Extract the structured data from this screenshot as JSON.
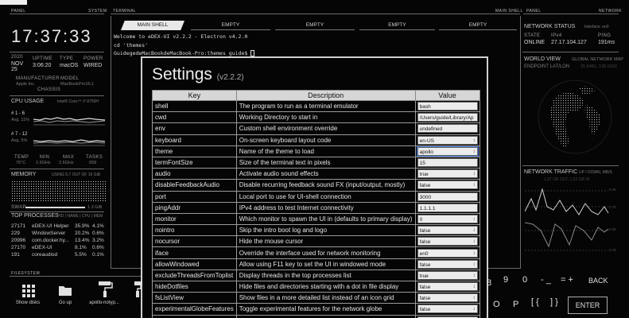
{
  "window": {
    "title": "eDEX-UI"
  },
  "panels": {
    "left": "PANEL",
    "system": "SYSTEM",
    "terminal": "TERMINAL",
    "main_shell_hdr": "MAIN SHELL",
    "right": "PANEL",
    "network": "NETWORK",
    "filesystem": "FILESYSTEM"
  },
  "clock": "17:37:33",
  "sysinfo": {
    "year": "2020",
    "month": "NOV",
    "day": "25",
    "uptime_label": "UPTIME",
    "uptime": "3:06:20",
    "type_label": "TYPE",
    "type": "macOS",
    "power_label": "POWER",
    "power": "WIRED",
    "manufacturer_label": "MANUFACTURER",
    "manufacturer": "Apple Inc.",
    "model_label": "MODEL",
    "model": "MacBookPro16,1",
    "chassis_label": "CHASSIS"
  },
  "cpu": {
    "label": "CPU USAGE",
    "model": "Intel® Core™ i7-9750H",
    "cores1": "# 1 - 6",
    "avg1": "Avg. 11%",
    "cores2": "# 7 - 12",
    "avg2": "Avg. 5%",
    "temp_label": "TEMP",
    "temp": "76°C",
    "min_label": "MIN",
    "min": "2.6GHz",
    "max_label": "MAX",
    "max": "2.6GHz",
    "tasks_label": "TASKS",
    "tasks": "658"
  },
  "memory": {
    "label": "MEMORY",
    "using": "USING 5.7 OUT OF 16 GiB",
    "swap_label": "SWAP",
    "swap": "1.3 GiB"
  },
  "processes": {
    "label": "TOP PROCESSES",
    "cols": "PID | NAME | CPU | MEM",
    "rows": [
      {
        "pid": "27171",
        "name": "eDEX-UI Helper",
        "cpu": "35.9%",
        "mem": "4.1%"
      },
      {
        "pid": "229",
        "name": "WindowServer",
        "cpu": "20.2%",
        "mem": "0.6%"
      },
      {
        "pid": "20996",
        "name": "com.docker.hy...",
        "cpu": "13.4%",
        "mem": "3.2%"
      },
      {
        "pid": "27170",
        "name": "eDEX-UI",
        "cpu": "8.1%",
        "mem": "0.6%"
      },
      {
        "pid": "191",
        "name": "coreaudiod",
        "cpu": "5.5%",
        "mem": "0.1%"
      }
    ]
  },
  "tabs": [
    "MAIN SHELL",
    "EMPTY",
    "EMPTY",
    "EMPTY",
    "EMPTY"
  ],
  "terminal_lines": [
    "Welcome to eDEX-UI v2.2.2 - Electron v4.2.0",
    "cd 'themes'",
    "GuidegedeMacBookdeMacBook-Pro:themes guide$ "
  ],
  "settings": {
    "title": "Settings",
    "version": "(v2.2.2)",
    "headers": [
      "Key",
      "Description",
      "Value"
    ],
    "rows": [
      {
        "key": "shell",
        "desc": "The program to run as a terminal emulator",
        "value": "bash",
        "kind": "text"
      },
      {
        "key": "cwd",
        "desc": "Working Directory to start in",
        "value": "/Users/guide/Library/Ap",
        "kind": "text"
      },
      {
        "key": "env",
        "desc": "Custom shell environment override",
        "value": "undefined",
        "kind": "text"
      },
      {
        "key": "keyboard",
        "desc": "On-screen keyboard layout code",
        "value": "en-US",
        "kind": "select"
      },
      {
        "key": "theme",
        "desc": "Name of the theme to load",
        "value": "apollo",
        "kind": "select-focus"
      },
      {
        "key": "termFontSize",
        "desc": "Size of the terminal text in pixels",
        "value": "15",
        "kind": "text"
      },
      {
        "key": "audio",
        "desc": "Activate audio sound effects",
        "value": "true",
        "kind": "select"
      },
      {
        "key": "disableFeedbackAudio",
        "desc": "Disable recurring feedback sound FX (input/output, mostly)",
        "value": "false",
        "kind": "select"
      },
      {
        "key": "port",
        "desc": "Local port to use for UI-shell connection",
        "value": "3000",
        "kind": "text"
      },
      {
        "key": "pingAddr",
        "desc": "IPv4 address to test Internet connectivity",
        "value": "1.1.1.1",
        "kind": "text"
      },
      {
        "key": "monitor",
        "desc": "Which monitor to spawn the UI in (defaults to primary display)",
        "value": "0",
        "kind": "select"
      },
      {
        "key": "nointro",
        "desc": "Skip the intro boot log and logo",
        "value": "false",
        "kind": "select"
      },
      {
        "key": "nocursor",
        "desc": "Hide the mouse cursor",
        "value": "false",
        "kind": "select"
      },
      {
        "key": "iface",
        "desc": "Override the interface used for network monitoring",
        "value": "en0",
        "kind": "select"
      },
      {
        "key": "allowWindowed",
        "desc": "Allow using F11 key to set the UI in windowed mode",
        "value": "false",
        "kind": "select"
      },
      {
        "key": "excludeThreadsFromToplist",
        "desc": "Display threads in the top processes list",
        "value": "true",
        "kind": "select"
      },
      {
        "key": "hideDotfiles",
        "desc": "Hide files and directories starting with a dot in file display",
        "value": "false",
        "kind": "select"
      },
      {
        "key": "fsListView",
        "desc": "Show files in a more detailed list instead of an icon grid",
        "value": "false",
        "kind": "select"
      },
      {
        "key": "experimentalGlobeFeatures",
        "desc": "Toggle experimental features for the network globe",
        "value": "false",
        "kind": "select"
      },
      {
        "key": "experimentalFeatures",
        "desc": "Toggle Chrome's experimental web features (DANGEROUS)",
        "value": "false",
        "kind": "select"
      }
    ]
  },
  "network": {
    "status_label": "NETWORK STATUS",
    "iface": "Interface: en0",
    "state_label": "STATE",
    "state": "ONLINE",
    "ipv4_label": "IPv4",
    "ipv4": "27.17.104.127",
    "ping_label": "PING",
    "ping": "191ms",
    "world_label": "WORLD VIEW",
    "map_label": "GLOBAL NETWORK MAP",
    "endpoint": "ENDPOINT LAT/LON",
    "endpoint_val": "35.8481, 139.6932",
    "traffic_label": "NETWORK TRAFFIC",
    "traffic_unit": "UP / DOWN, MB/S",
    "total": "1.97 GB OUT, 1.52 GB IN",
    "ticks_up": [
      "0.25",
      "0.75"
    ],
    "ticks_down": [
      "0.25",
      "0.75"
    ]
  },
  "filesystem": {
    "items": [
      {
        "label": "Show disks",
        "icon": "grid-icon"
      },
      {
        "label": "Go up",
        "icon": "folder-up-icon"
      },
      {
        "label": "apollo-notyp...",
        "icon": "paint-roller-icon"
      },
      {
        "label": "apollo.json",
        "icon": "paint-roller-icon"
      },
      {
        "label": "blade.json",
        "icon": "paint-roller-icon"
      }
    ]
  },
  "keyboard": {
    "row1": [
      "8",
      "9",
      "0",
      "- _",
      "= +",
      "BACK"
    ],
    "row2": [
      "O",
      "P",
      "[ {",
      "] }",
      "ENTER"
    ]
  }
}
